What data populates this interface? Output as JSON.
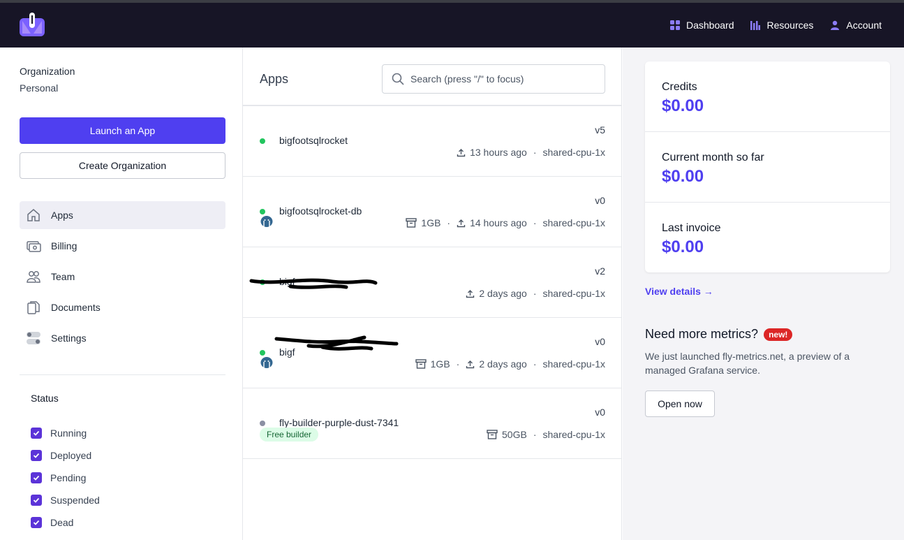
{
  "topnav": {
    "dashboard": "Dashboard",
    "resources": "Resources",
    "account": "Account"
  },
  "sidebar": {
    "org_label": "Organization",
    "org_value": "Personal",
    "launch_label": "Launch an App",
    "create_org_label": "Create Organization",
    "nav": [
      {
        "label": "Apps",
        "icon": "home-icon"
      },
      {
        "label": "Billing",
        "icon": "billing-icon"
      },
      {
        "label": "Team",
        "icon": "team-icon"
      },
      {
        "label": "Documents",
        "icon": "documents-icon"
      },
      {
        "label": "Settings",
        "icon": "settings-icon"
      }
    ],
    "status_title": "Status",
    "statuses": [
      "Running",
      "Deployed",
      "Pending",
      "Suspended",
      "Dead"
    ]
  },
  "apps": {
    "title": "Apps",
    "search_placeholder": "Search (press \"/\" to focus)",
    "items": [
      {
        "name": "bigfootsqlrocket",
        "version": "v5",
        "deployed": "13 hours ago",
        "size": "shared-cpu-1x"
      },
      {
        "name": "bigfootsqlrocket-db",
        "version": "v0",
        "volume": "1GB",
        "deployed": "14 hours ago",
        "size": "shared-cpu-1x"
      },
      {
        "name": "bigf",
        "version": "v2",
        "deployed": "2 days ago",
        "size": "shared-cpu-1x"
      },
      {
        "name": "bigf",
        "version": "v0",
        "volume": "1GB",
        "deployed": "2 days ago",
        "size": "shared-cpu-1x"
      },
      {
        "name": "fly-builder-purple-dust-7341",
        "version": "v0",
        "badge": "Free builder",
        "volume": "50GB",
        "size": "shared-cpu-1x"
      }
    ],
    "separator": "·"
  },
  "billing": {
    "credits_label": "Credits",
    "credits_value": "$0.00",
    "month_label": "Current month so far",
    "month_value": "$0.00",
    "invoice_label": "Last invoice",
    "invoice_value": "$0.00",
    "view_details": "View details →"
  },
  "metrics": {
    "title": "Need more metrics?",
    "badge": "new!",
    "description": "We just launched fly-metrics.net, a preview of a managed Grafana service.",
    "button": "Open now"
  },
  "colors": {
    "accent": "#4f3ff0",
    "topbar": "#171526",
    "running": "#22c55e"
  }
}
